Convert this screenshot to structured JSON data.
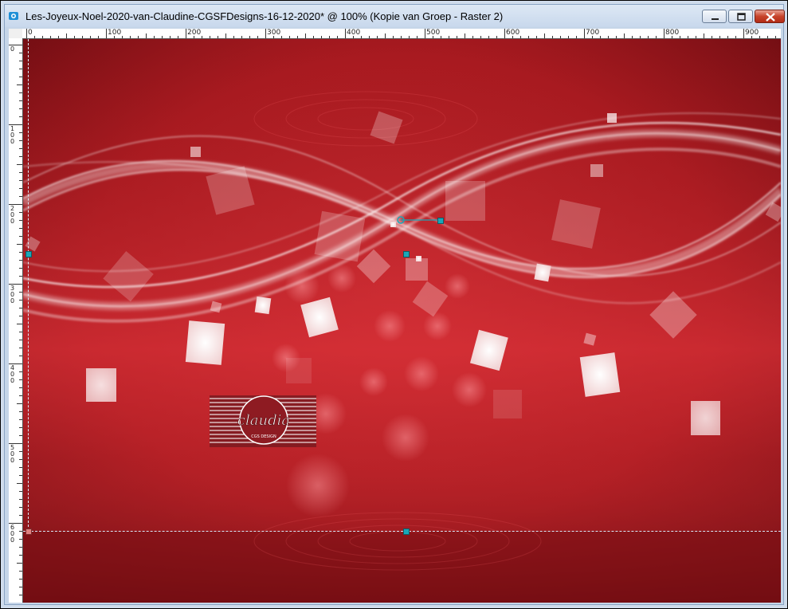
{
  "window": {
    "title": "Les-Joyeux-Noel-2020-van-Claudine-CGSFDesigns-16-12-2020* @ 100% (Kopie van Groep - Raster 2)",
    "icon": "psp-image-icon",
    "buttons": {
      "minimize": "minimize-icon",
      "maximize": "maximize-icon",
      "close": "close-icon"
    }
  },
  "ruler_h": {
    "labels": [
      "0",
      "100",
      "200",
      "300",
      "400",
      "500",
      "600",
      "700",
      "800",
      "900"
    ]
  },
  "ruler_v": {
    "labels": [
      "0",
      "100",
      "200",
      "300",
      "400",
      "500",
      "600"
    ]
  },
  "canvas": {
    "colors": {
      "background": "#b01c22",
      "dark": "#6e0d12",
      "light_band": "#d93a3f",
      "highlight": "#ffffff"
    },
    "watermark": {
      "text": "claudia",
      "subtext": "CGS DESIGN"
    }
  }
}
